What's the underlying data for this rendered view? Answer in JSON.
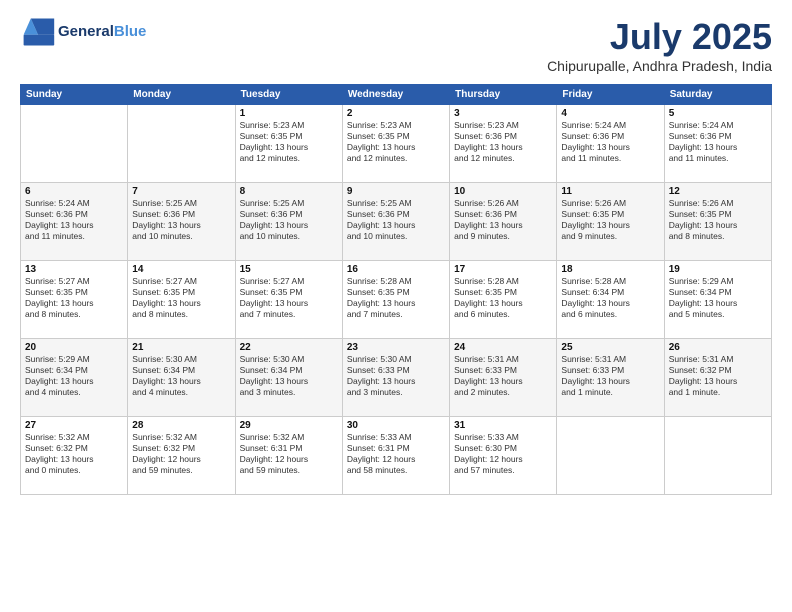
{
  "header": {
    "logo_line1": "General",
    "logo_line2": "Blue",
    "month": "July 2025",
    "location": "Chipurupalle, Andhra Pradesh, India"
  },
  "weekdays": [
    "Sunday",
    "Monday",
    "Tuesday",
    "Wednesday",
    "Thursday",
    "Friday",
    "Saturday"
  ],
  "weeks": [
    [
      {
        "day": "",
        "detail": ""
      },
      {
        "day": "",
        "detail": ""
      },
      {
        "day": "1",
        "detail": "Sunrise: 5:23 AM\nSunset: 6:35 PM\nDaylight: 13 hours\nand 12 minutes."
      },
      {
        "day": "2",
        "detail": "Sunrise: 5:23 AM\nSunset: 6:35 PM\nDaylight: 13 hours\nand 12 minutes."
      },
      {
        "day": "3",
        "detail": "Sunrise: 5:23 AM\nSunset: 6:36 PM\nDaylight: 13 hours\nand 12 minutes."
      },
      {
        "day": "4",
        "detail": "Sunrise: 5:24 AM\nSunset: 6:36 PM\nDaylight: 13 hours\nand 11 minutes."
      },
      {
        "day": "5",
        "detail": "Sunrise: 5:24 AM\nSunset: 6:36 PM\nDaylight: 13 hours\nand 11 minutes."
      }
    ],
    [
      {
        "day": "6",
        "detail": "Sunrise: 5:24 AM\nSunset: 6:36 PM\nDaylight: 13 hours\nand 11 minutes."
      },
      {
        "day": "7",
        "detail": "Sunrise: 5:25 AM\nSunset: 6:36 PM\nDaylight: 13 hours\nand 10 minutes."
      },
      {
        "day": "8",
        "detail": "Sunrise: 5:25 AM\nSunset: 6:36 PM\nDaylight: 13 hours\nand 10 minutes."
      },
      {
        "day": "9",
        "detail": "Sunrise: 5:25 AM\nSunset: 6:36 PM\nDaylight: 13 hours\nand 10 minutes."
      },
      {
        "day": "10",
        "detail": "Sunrise: 5:26 AM\nSunset: 6:36 PM\nDaylight: 13 hours\nand 9 minutes."
      },
      {
        "day": "11",
        "detail": "Sunrise: 5:26 AM\nSunset: 6:35 PM\nDaylight: 13 hours\nand 9 minutes."
      },
      {
        "day": "12",
        "detail": "Sunrise: 5:26 AM\nSunset: 6:35 PM\nDaylight: 13 hours\nand 8 minutes."
      }
    ],
    [
      {
        "day": "13",
        "detail": "Sunrise: 5:27 AM\nSunset: 6:35 PM\nDaylight: 13 hours\nand 8 minutes."
      },
      {
        "day": "14",
        "detail": "Sunrise: 5:27 AM\nSunset: 6:35 PM\nDaylight: 13 hours\nand 8 minutes."
      },
      {
        "day": "15",
        "detail": "Sunrise: 5:27 AM\nSunset: 6:35 PM\nDaylight: 13 hours\nand 7 minutes."
      },
      {
        "day": "16",
        "detail": "Sunrise: 5:28 AM\nSunset: 6:35 PM\nDaylight: 13 hours\nand 7 minutes."
      },
      {
        "day": "17",
        "detail": "Sunrise: 5:28 AM\nSunset: 6:35 PM\nDaylight: 13 hours\nand 6 minutes."
      },
      {
        "day": "18",
        "detail": "Sunrise: 5:28 AM\nSunset: 6:34 PM\nDaylight: 13 hours\nand 6 minutes."
      },
      {
        "day": "19",
        "detail": "Sunrise: 5:29 AM\nSunset: 6:34 PM\nDaylight: 13 hours\nand 5 minutes."
      }
    ],
    [
      {
        "day": "20",
        "detail": "Sunrise: 5:29 AM\nSunset: 6:34 PM\nDaylight: 13 hours\nand 4 minutes."
      },
      {
        "day": "21",
        "detail": "Sunrise: 5:30 AM\nSunset: 6:34 PM\nDaylight: 13 hours\nand 4 minutes."
      },
      {
        "day": "22",
        "detail": "Sunrise: 5:30 AM\nSunset: 6:34 PM\nDaylight: 13 hours\nand 3 minutes."
      },
      {
        "day": "23",
        "detail": "Sunrise: 5:30 AM\nSunset: 6:33 PM\nDaylight: 13 hours\nand 3 minutes."
      },
      {
        "day": "24",
        "detail": "Sunrise: 5:31 AM\nSunset: 6:33 PM\nDaylight: 13 hours\nand 2 minutes."
      },
      {
        "day": "25",
        "detail": "Sunrise: 5:31 AM\nSunset: 6:33 PM\nDaylight: 13 hours\nand 1 minute."
      },
      {
        "day": "26",
        "detail": "Sunrise: 5:31 AM\nSunset: 6:32 PM\nDaylight: 13 hours\nand 1 minute."
      }
    ],
    [
      {
        "day": "27",
        "detail": "Sunrise: 5:32 AM\nSunset: 6:32 PM\nDaylight: 13 hours\nand 0 minutes."
      },
      {
        "day": "28",
        "detail": "Sunrise: 5:32 AM\nSunset: 6:32 PM\nDaylight: 12 hours\nand 59 minutes."
      },
      {
        "day": "29",
        "detail": "Sunrise: 5:32 AM\nSunset: 6:31 PM\nDaylight: 12 hours\nand 59 minutes."
      },
      {
        "day": "30",
        "detail": "Sunrise: 5:33 AM\nSunset: 6:31 PM\nDaylight: 12 hours\nand 58 minutes."
      },
      {
        "day": "31",
        "detail": "Sunrise: 5:33 AM\nSunset: 6:30 PM\nDaylight: 12 hours\nand 57 minutes."
      },
      {
        "day": "",
        "detail": ""
      },
      {
        "day": "",
        "detail": ""
      }
    ]
  ]
}
